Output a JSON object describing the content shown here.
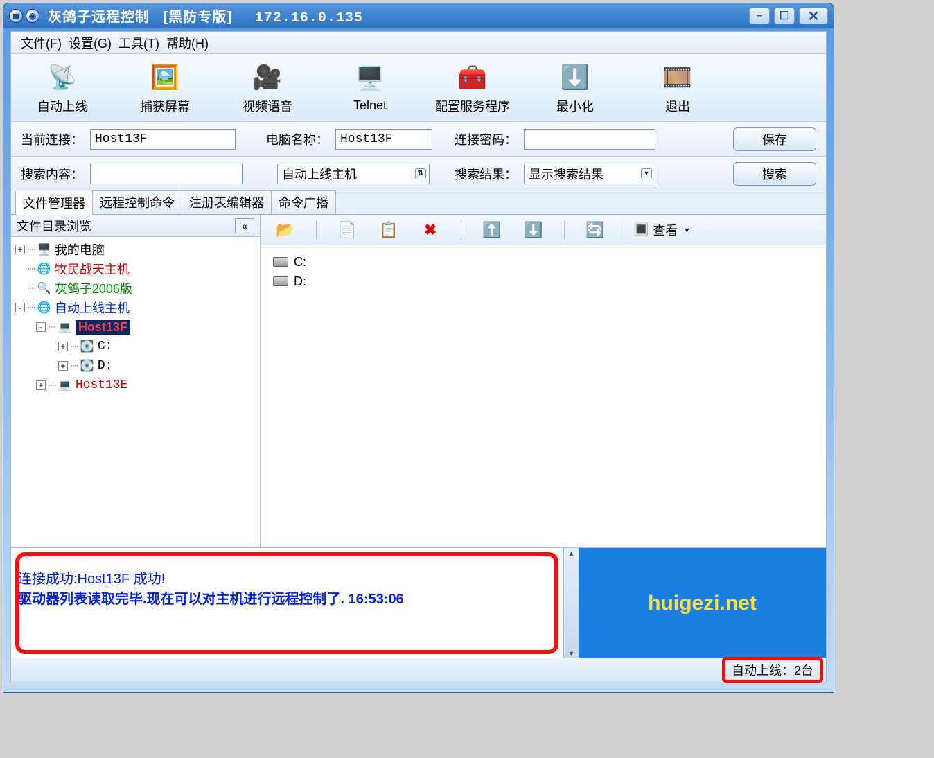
{
  "title": {
    "app": "灰鸽子远程控制",
    "edition": "[黑防专版]",
    "ip": "172.16.0.135"
  },
  "menu": {
    "file": "文件(F)",
    "settings": "设置(G)",
    "tools": "工具(T)",
    "help": "帮助(H)"
  },
  "toolbar": {
    "autoOnline": "自动上线",
    "capture": "捕获屏幕",
    "av": "视频语音",
    "telnet": "Telnet",
    "config": "配置服务程序",
    "minimize": "最小化",
    "exit": "退出"
  },
  "conn": {
    "curLabel": "当前连接：",
    "curValue": "Host13F",
    "pcLabel": "电脑名称：",
    "pcValue": "Host13F",
    "pwLabel": "连接密码：",
    "pwValue": "",
    "save": "保存"
  },
  "search": {
    "contentLabel": "搜索内容：",
    "contentValue": "",
    "scope": "自动上线主机",
    "resultLabel": "搜索结果：",
    "resultValue": "显示搜索结果",
    "btn": "搜索"
  },
  "tabs": {
    "t1": "文件管理器",
    "t2": "远程控制命令",
    "t3": "注册表编辑器",
    "t4": "命令广播"
  },
  "tree": {
    "header": "文件目录浏览",
    "mypc": "我的电脑",
    "grp1": "牧民战天主机",
    "grp2": "灰鸽子2006版",
    "grp3": "自动上线主机",
    "host1": "Host13F",
    "drvC": "C:",
    "drvD": "D:",
    "host2": "Host13E"
  },
  "filetb": {
    "view": "查看"
  },
  "drives": {
    "c": "C:",
    "d": "D:"
  },
  "log": {
    "line1": "连接成功:Host13F 成功!",
    "line2": "驱动器列表读取完毕.现在可以对主机进行远程控制了.  16:53:06"
  },
  "brand": "huigezi.net",
  "status": {
    "text": "自动上线：2台"
  }
}
